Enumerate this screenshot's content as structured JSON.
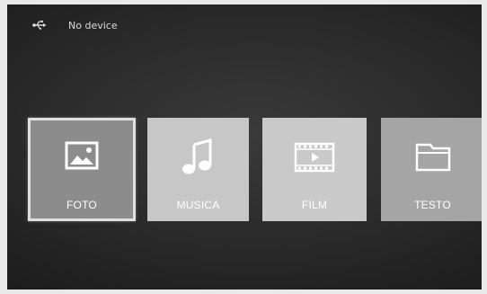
{
  "status_bar": {
    "icon": "usb-icon",
    "text": "No device"
  },
  "menu": {
    "selected": "FOTO",
    "tiles": [
      {
        "label": "FOTO",
        "icon": "photo-icon",
        "color": "#8c8c8c",
        "selected": true
      },
      {
        "label": "MUSICA",
        "icon": "music-note-icon",
        "color": "#c7c7c7",
        "selected": false
      },
      {
        "label": "FILM",
        "icon": "film-icon",
        "color": "#c9c9c9",
        "selected": false
      },
      {
        "label": "TESTO",
        "icon": "folder-icon",
        "color": "#a5a5a5",
        "selected": false
      }
    ]
  },
  "colors": {
    "background": "#2a2a2a",
    "selection_border": "#e0e0e0",
    "text": "#ffffff"
  }
}
